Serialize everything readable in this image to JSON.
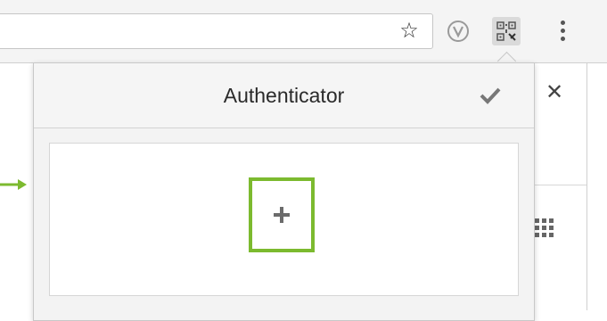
{
  "browser": {
    "toolbar_icons": [
      "star-icon",
      "vivaldi-icon",
      "qr-code-extension-icon",
      "menu-icon"
    ],
    "page_icons": [
      "close-icon",
      "apps-grid-icon"
    ]
  },
  "popup": {
    "title": "Authenticator",
    "header_icons": [
      "check-icon"
    ],
    "add_button_icon": "plus-icon",
    "highlight_color": "#7cba2f",
    "annotation_arrow_color": "#7cba2f"
  }
}
